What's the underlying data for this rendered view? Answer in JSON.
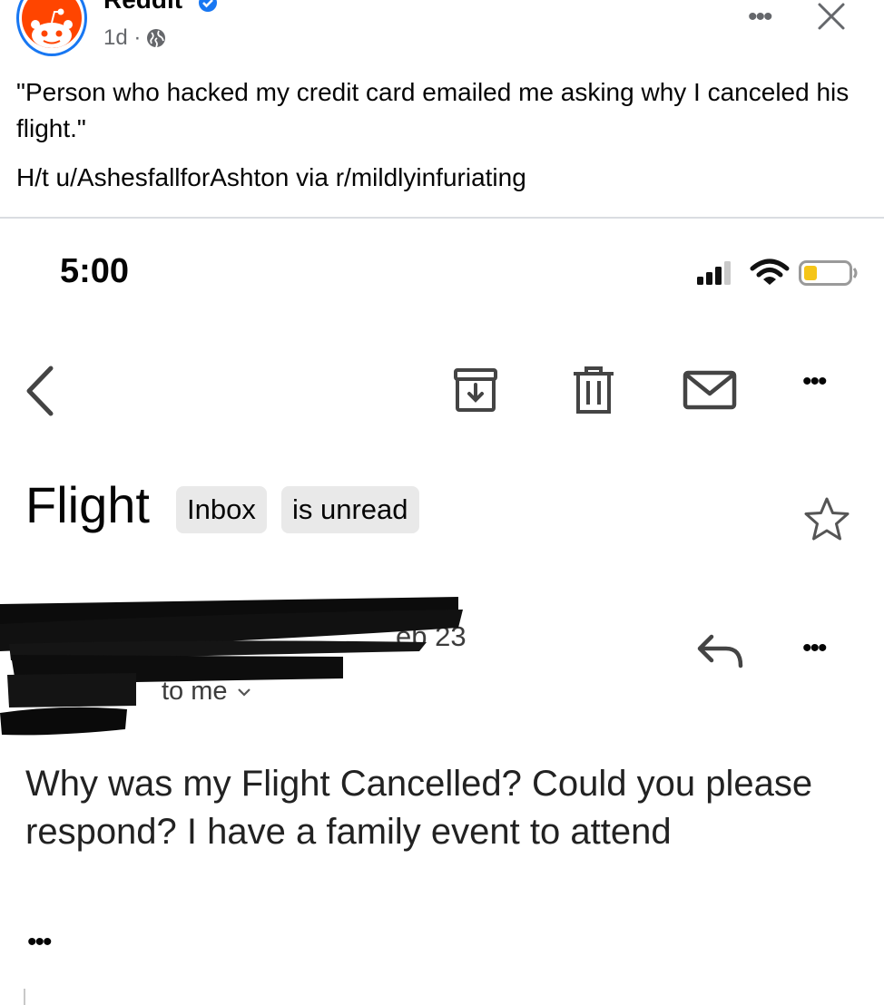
{
  "post": {
    "page_name": "Reddit",
    "time_ago": "1d ·",
    "caption": "\"Person who hacked my credit card emailed me asking why I canceled his flight.\"",
    "credit": "H/t u/AshesfallforAshton via r/mildlyinfuriating",
    "more_label": "•••",
    "icons": [
      "reddit-logo",
      "verified-badge-icon",
      "globe-icon",
      "more-options-icon",
      "close-icon"
    ],
    "accent_color": "#1877f2",
    "brand_color": "#ff4500"
  },
  "phone": {
    "time": "5:00",
    "icons": [
      "signal-icon",
      "wifi-icon",
      "battery-icon"
    ],
    "battery_color": "#f5c518"
  },
  "mail": {
    "toolbar_icons": [
      "back-icon",
      "archive-icon",
      "trash-icon",
      "mark-unread-icon",
      "more-options-icon"
    ],
    "more_label": "•••",
    "subject": "Flight",
    "labels": [
      "Inbox",
      "is unread"
    ],
    "date_fragment": "eb 23",
    "to_me": "to me",
    "body": "Why was my Flight Cancelled? Could you please respond? I have a family event to attend",
    "trimmed_content": "•••"
  }
}
